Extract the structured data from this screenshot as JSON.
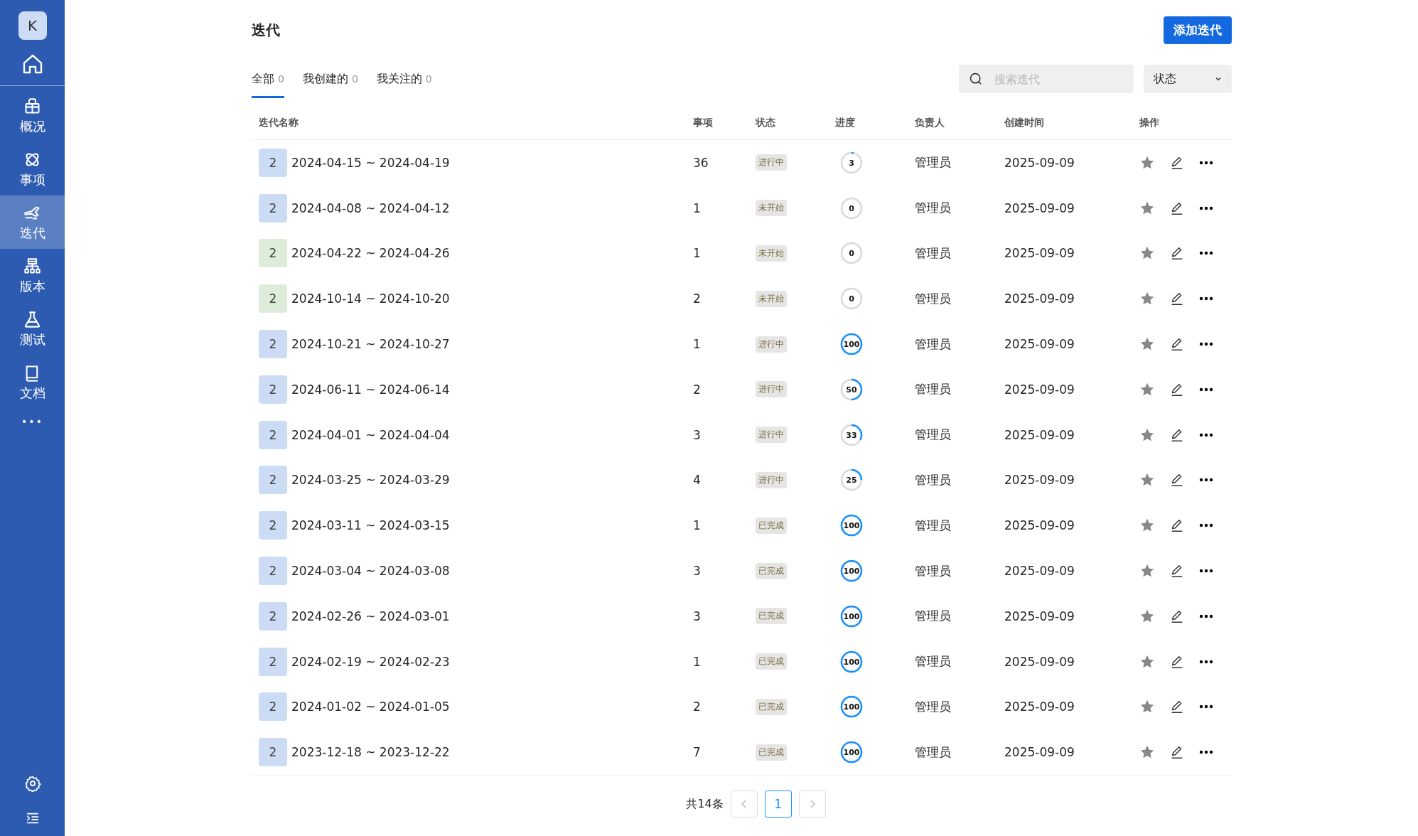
{
  "sidebar": {
    "avatar": "K",
    "items": [
      {
        "label": "概况",
        "selected": false
      },
      {
        "label": "事项",
        "selected": false
      },
      {
        "label": "迭代",
        "selected": true
      },
      {
        "label": "版本",
        "selected": false
      },
      {
        "label": "测试",
        "selected": false
      },
      {
        "label": "文档",
        "selected": false
      }
    ],
    "more": "•••"
  },
  "page": {
    "title": "迭代",
    "add_button": "添加迭代"
  },
  "tabs": [
    {
      "label": "全部",
      "count": "0",
      "selected": true
    },
    {
      "label": "我创建的",
      "count": "0",
      "selected": false
    },
    {
      "label": "我关注的",
      "count": "0",
      "selected": false
    }
  ],
  "search": {
    "placeholder": "搜索迭代"
  },
  "status_filter": {
    "label": "状态"
  },
  "table": {
    "columns": [
      "迭代名称",
      "事项",
      "状态",
      "进度",
      "负责人",
      "创建时间",
      "操作"
    ],
    "rows": [
      {
        "icon": "2",
        "color": "#cddcf5",
        "name": "2024-04-15 ~ 2024-04-19",
        "items": "36",
        "status": "进行中",
        "progress": "3",
        "owner": "管理员",
        "created": "2025-09-09"
      },
      {
        "icon": "2",
        "color": "#cddcf5",
        "name": "2024-04-08 ~ 2024-04-12",
        "items": "1",
        "status": "未开始",
        "progress": "0",
        "owner": "管理员",
        "created": "2025-09-09"
      },
      {
        "icon": "2",
        "color": "#deedd9",
        "name": "2024-04-22 ~ 2024-04-26",
        "items": "1",
        "status": "未开始",
        "progress": "0",
        "owner": "管理员",
        "created": "2025-09-09"
      },
      {
        "icon": "2",
        "color": "#deedd9",
        "name": "2024-10-14 ~ 2024-10-20",
        "items": "2",
        "status": "未开始",
        "progress": "0",
        "owner": "管理员",
        "created": "2025-09-09"
      },
      {
        "icon": "2",
        "color": "#cddcf5",
        "name": "2024-10-21 ~ 2024-10-27",
        "items": "1",
        "status": "进行中",
        "progress": "100",
        "owner": "管理员",
        "created": "2025-09-09"
      },
      {
        "icon": "2",
        "color": "#cddcf5",
        "name": "2024-06-11 ~ 2024-06-14",
        "items": "2",
        "status": "进行中",
        "progress": "50",
        "owner": "管理员",
        "created": "2025-09-09"
      },
      {
        "icon": "2",
        "color": "#cddcf5",
        "name": "2024-04-01 ~ 2024-04-04",
        "items": "3",
        "status": "进行中",
        "progress": "33",
        "owner": "管理员",
        "created": "2025-09-09"
      },
      {
        "icon": "2",
        "color": "#cddcf5",
        "name": "2024-03-25 ~ 2024-03-29",
        "items": "4",
        "status": "进行中",
        "progress": "25",
        "owner": "管理员",
        "created": "2025-09-09"
      },
      {
        "icon": "2",
        "color": "#cddcf5",
        "name": "2024-03-11 ~ 2024-03-15",
        "items": "1",
        "status": "已完成",
        "progress": "100",
        "owner": "管理员",
        "created": "2025-09-09"
      },
      {
        "icon": "2",
        "color": "#cddcf5",
        "name": "2024-03-04 ~ 2024-03-08",
        "items": "3",
        "status": "已完成",
        "progress": "100",
        "owner": "管理员",
        "created": "2025-09-09"
      },
      {
        "icon": "2",
        "color": "#cddcf5",
        "name": "2024-02-26 ~ 2024-03-01",
        "items": "3",
        "status": "已完成",
        "progress": "100",
        "owner": "管理员",
        "created": "2025-09-09"
      },
      {
        "icon": "2",
        "color": "#cddcf5",
        "name": "2024-02-19 ~ 2024-02-23",
        "items": "1",
        "status": "已完成",
        "progress": "100",
        "owner": "管理员",
        "created": "2025-09-09"
      },
      {
        "icon": "2",
        "color": "#cddcf5",
        "name": "2024-01-02 ~ 2024-01-05",
        "items": "2",
        "status": "已完成",
        "progress": "100",
        "owner": "管理员",
        "created": "2025-09-09"
      },
      {
        "icon": "2",
        "color": "#cddcf5",
        "name": "2023-12-18 ~ 2023-12-22",
        "items": "7",
        "status": "已完成",
        "progress": "100",
        "owner": "管理员",
        "created": "2025-09-09"
      }
    ]
  },
  "pagination": {
    "total": "共14条",
    "pages": [
      {
        "label": "1",
        "selected": true
      }
    ]
  }
}
